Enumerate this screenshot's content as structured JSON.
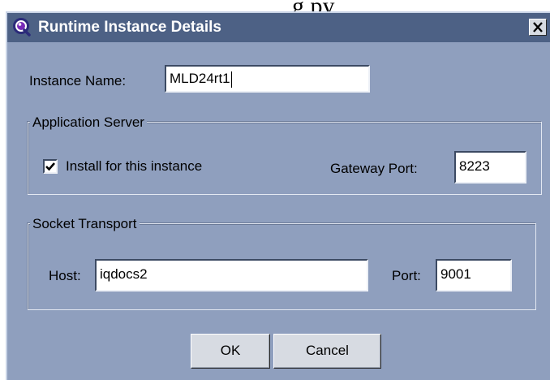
{
  "background_text": "g  py",
  "dialog": {
    "title": "Runtime Instance Details",
    "close_label": "X"
  },
  "instance": {
    "label": "Instance Name:",
    "value": "MLD24rt1"
  },
  "app_server": {
    "legend": "Application Server",
    "checkbox_label": "Install for this instance",
    "checkbox_checked": true,
    "gateway_label": "Gateway Port:",
    "gateway_value": "8223"
  },
  "socket": {
    "legend": "Socket Transport",
    "host_label": "Host:",
    "host_value": "iqdocs2",
    "port_label": "Port:",
    "port_value": "9001"
  },
  "buttons": {
    "ok": "OK",
    "cancel": "Cancel"
  },
  "colors": {
    "dialog_bg": "#8f9fbe",
    "titlebar": "#4d6185",
    "button_face": "#d7dbe2"
  }
}
